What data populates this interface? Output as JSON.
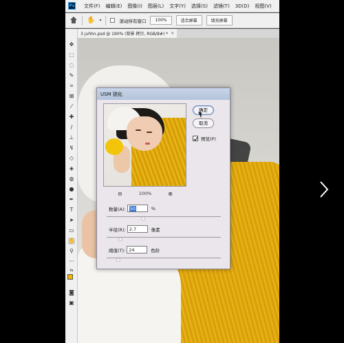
{
  "menubar": {
    "logo": "Ps",
    "items": [
      "文件(F)",
      "编辑(E)",
      "图像(I)",
      "图层(L)",
      "文字(Y)",
      "选择(S)",
      "滤镜(T)",
      "3D(D)",
      "视图(V)"
    ]
  },
  "options": {
    "scroll_all_label": "滚动所有窗口",
    "zoom_value": "100%",
    "fit_screen_label": "适合屏幕",
    "fill_screen_label": "填充屏幕"
  },
  "document": {
    "tab_title": "3 juhhn.psd @ 190% (背景 拷贝, RGB/8#) *",
    "close_symbol": "×"
  },
  "dialog": {
    "title": "USM 锐化",
    "ok_label": "确定",
    "cancel_label": "取消",
    "preview_label": "预览(P)",
    "preview_checked": true,
    "zoom_percent": "100%",
    "amount": {
      "label": "数量(A):",
      "value": "50",
      "unit": "%",
      "slider_fraction": 0.32
    },
    "radius": {
      "label": "半径(R):",
      "value": "2.7",
      "unit": "像素",
      "slider_fraction": 0.12
    },
    "threshold": {
      "label": "阈值(T):",
      "value": "24",
      "unit": "色阶",
      "slider_fraction": 0.1
    }
  },
  "icons": {
    "zoom_out": "zoom-out-icon",
    "zoom_in": "zoom-in-icon",
    "next": "chevron-right-icon"
  },
  "colors": {
    "foreground": "#f0b400",
    "background": "#111111",
    "ok_border": "#6d86b5"
  }
}
